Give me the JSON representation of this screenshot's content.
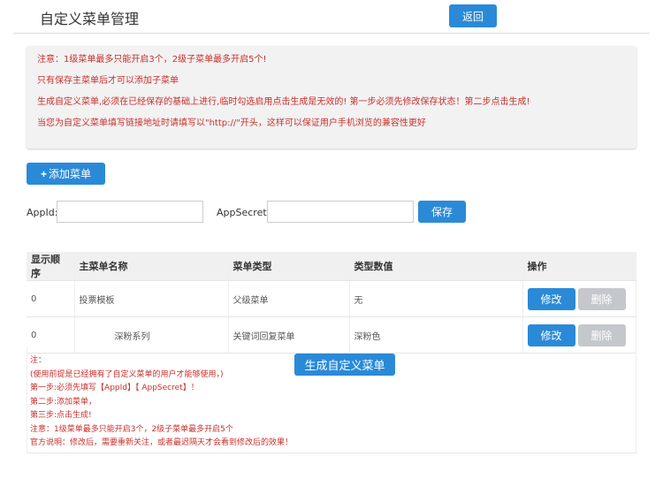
{
  "header": {
    "title": "自定义菜单管理",
    "back_label": "返回"
  },
  "notice": [
    "注意：1级菜单最多只能开启3个，2级子菜单最多开启5个!",
    "只有保存主菜单后才可以添加子菜单",
    "生成自定义菜单,必须在已经保存的基础上进行,临时勾选启用点击生成是无效的! 第一步必须先修改保存状态！第二步点击生成!",
    "当您为自定义菜单填写链接地址时请填写以\"http://\"开头，这样可以保证用户手机浏览的兼容性更好"
  ],
  "add_menu_label": "添加菜单",
  "form": {
    "appid_label": "AppId:",
    "appid_value": "",
    "appsecret_label": "AppSecret:",
    "appsecret_value": "",
    "save_label": "保存"
  },
  "table": {
    "headers": [
      "显示顺序",
      "主菜单名称",
      "菜单类型",
      "类型数值",
      "操作"
    ],
    "rows": [
      {
        "order": "0",
        "name": "投票模板",
        "type": "父级菜单",
        "value": "无",
        "edit": "修改",
        "delete": "删除"
      },
      {
        "order": "0",
        "name": "深粉系列",
        "type": "关键词回复菜单",
        "value": "深粉色",
        "edit": "修改",
        "delete": "删除"
      }
    ]
  },
  "generate_label": "生成自定义菜单",
  "notes": [
    "注：",
    "(使用前提是已经拥有了自定义菜单的用户才能够使用，)",
    "第一步:必须先填写【AppId】【 AppSecret】！",
    "第二步:添加菜单，",
    "第三步:点击生成!",
    "注意：1级菜单最多只能开启3个，2级子菜单最多开启5个",
    "官方说明：修改后，需要重新关注，或者最迟隔天才会看到修改后的效果！"
  ]
}
